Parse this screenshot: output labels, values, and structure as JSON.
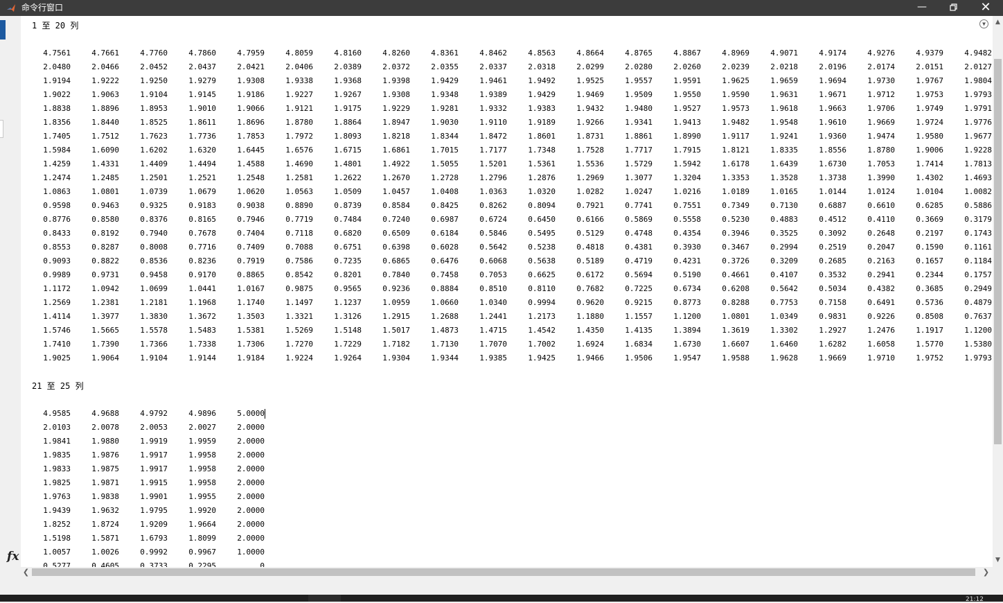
{
  "window": {
    "title": "命令行窗口",
    "controls": [
      "minimize-icon",
      "restore-icon",
      "close-icon"
    ],
    "accent": "#3c3c3c"
  },
  "console": {
    "block1_header": "1 至 20 列",
    "block2_header": "21 至 25 列",
    "block1_rows": [
      [
        "4.7561",
        "4.7661",
        "4.7760",
        "4.7860",
        "4.7959",
        "4.8059",
        "4.8160",
        "4.8260",
        "4.8361",
        "4.8462",
        "4.8563",
        "4.8664",
        "4.8765",
        "4.8867",
        "4.8969",
        "4.9071",
        "4.9174",
        "4.9276",
        "4.9379",
        "4.9482"
      ],
      [
        "2.0480",
        "2.0466",
        "2.0452",
        "2.0437",
        "2.0421",
        "2.0406",
        "2.0389",
        "2.0372",
        "2.0355",
        "2.0337",
        "2.0318",
        "2.0299",
        "2.0280",
        "2.0260",
        "2.0239",
        "2.0218",
        "2.0196",
        "2.0174",
        "2.0151",
        "2.0127"
      ],
      [
        "1.9194",
        "1.9222",
        "1.9250",
        "1.9279",
        "1.9308",
        "1.9338",
        "1.9368",
        "1.9398",
        "1.9429",
        "1.9461",
        "1.9492",
        "1.9525",
        "1.9557",
        "1.9591",
        "1.9625",
        "1.9659",
        "1.9694",
        "1.9730",
        "1.9767",
        "1.9804"
      ],
      [
        "1.9022",
        "1.9063",
        "1.9104",
        "1.9145",
        "1.9186",
        "1.9227",
        "1.9267",
        "1.9308",
        "1.9348",
        "1.9389",
        "1.9429",
        "1.9469",
        "1.9509",
        "1.9550",
        "1.9590",
        "1.9631",
        "1.9671",
        "1.9712",
        "1.9753",
        "1.9793"
      ],
      [
        "1.8838",
        "1.8896",
        "1.8953",
        "1.9010",
        "1.9066",
        "1.9121",
        "1.9175",
        "1.9229",
        "1.9281",
        "1.9332",
        "1.9383",
        "1.9432",
        "1.9480",
        "1.9527",
        "1.9573",
        "1.9618",
        "1.9663",
        "1.9706",
        "1.9749",
        "1.9791"
      ],
      [
        "1.8356",
        "1.8440",
        "1.8525",
        "1.8611",
        "1.8696",
        "1.8780",
        "1.8864",
        "1.8947",
        "1.9030",
        "1.9110",
        "1.9189",
        "1.9266",
        "1.9341",
        "1.9413",
        "1.9482",
        "1.9548",
        "1.9610",
        "1.9669",
        "1.9724",
        "1.9776"
      ],
      [
        "1.7405",
        "1.7512",
        "1.7623",
        "1.7736",
        "1.7853",
        "1.7972",
        "1.8093",
        "1.8218",
        "1.8344",
        "1.8472",
        "1.8601",
        "1.8731",
        "1.8861",
        "1.8990",
        "1.9117",
        "1.9241",
        "1.9360",
        "1.9474",
        "1.9580",
        "1.9677"
      ],
      [
        "1.5984",
        "1.6090",
        "1.6202",
        "1.6320",
        "1.6445",
        "1.6576",
        "1.6715",
        "1.6861",
        "1.7015",
        "1.7177",
        "1.7348",
        "1.7528",
        "1.7717",
        "1.7915",
        "1.8121",
        "1.8335",
        "1.8556",
        "1.8780",
        "1.9006",
        "1.9228"
      ],
      [
        "1.4259",
        "1.4331",
        "1.4409",
        "1.4494",
        "1.4588",
        "1.4690",
        "1.4801",
        "1.4922",
        "1.5055",
        "1.5201",
        "1.5361",
        "1.5536",
        "1.5729",
        "1.5942",
        "1.6178",
        "1.6439",
        "1.6730",
        "1.7053",
        "1.7414",
        "1.7813"
      ],
      [
        "1.2474",
        "1.2485",
        "1.2501",
        "1.2521",
        "1.2548",
        "1.2581",
        "1.2622",
        "1.2670",
        "1.2728",
        "1.2796",
        "1.2876",
        "1.2969",
        "1.3077",
        "1.3204",
        "1.3353",
        "1.3528",
        "1.3738",
        "1.3990",
        "1.4302",
        "1.4693"
      ],
      [
        "1.0863",
        "1.0801",
        "1.0739",
        "1.0679",
        "1.0620",
        "1.0563",
        "1.0509",
        "1.0457",
        "1.0408",
        "1.0363",
        "1.0320",
        "1.0282",
        "1.0247",
        "1.0216",
        "1.0189",
        "1.0165",
        "1.0144",
        "1.0124",
        "1.0104",
        "1.0082"
      ],
      [
        "0.9598",
        "0.9463",
        "0.9325",
        "0.9183",
        "0.9038",
        "0.8890",
        "0.8739",
        "0.8584",
        "0.8425",
        "0.8262",
        "0.8094",
        "0.7921",
        "0.7741",
        "0.7551",
        "0.7349",
        "0.7130",
        "0.6887",
        "0.6610",
        "0.6285",
        "0.5886"
      ],
      [
        "0.8776",
        "0.8580",
        "0.8376",
        "0.8165",
        "0.7946",
        "0.7719",
        "0.7484",
        "0.7240",
        "0.6987",
        "0.6724",
        "0.6450",
        "0.6166",
        "0.5869",
        "0.5558",
        "0.5230",
        "0.4883",
        "0.4512",
        "0.4110",
        "0.3669",
        "0.3179"
      ],
      [
        "0.8433",
        "0.8192",
        "0.7940",
        "0.7678",
        "0.7404",
        "0.7118",
        "0.6820",
        "0.6509",
        "0.6184",
        "0.5846",
        "0.5495",
        "0.5129",
        "0.4748",
        "0.4354",
        "0.3946",
        "0.3525",
        "0.3092",
        "0.2648",
        "0.2197",
        "0.1743"
      ],
      [
        "0.8553",
        "0.8287",
        "0.8008",
        "0.7716",
        "0.7409",
        "0.7088",
        "0.6751",
        "0.6398",
        "0.6028",
        "0.5642",
        "0.5238",
        "0.4818",
        "0.4381",
        "0.3930",
        "0.3467",
        "0.2994",
        "0.2519",
        "0.2047",
        "0.1590",
        "0.1161"
      ],
      [
        "0.9093",
        "0.8822",
        "0.8536",
        "0.8236",
        "0.7919",
        "0.7586",
        "0.7235",
        "0.6865",
        "0.6476",
        "0.6068",
        "0.5638",
        "0.5189",
        "0.4719",
        "0.4231",
        "0.3726",
        "0.3209",
        "0.2685",
        "0.2163",
        "0.1657",
        "0.1184"
      ],
      [
        "0.9989",
        "0.9731",
        "0.9458",
        "0.9170",
        "0.8865",
        "0.8542",
        "0.8201",
        "0.7840",
        "0.7458",
        "0.7053",
        "0.6625",
        "0.6172",
        "0.5694",
        "0.5190",
        "0.4661",
        "0.4107",
        "0.3532",
        "0.2941",
        "0.2344",
        "0.1757"
      ],
      [
        "1.1172",
        "1.0942",
        "1.0699",
        "1.0441",
        "1.0167",
        "0.9875",
        "0.9565",
        "0.9236",
        "0.8884",
        "0.8510",
        "0.8110",
        "0.7682",
        "0.7225",
        "0.6734",
        "0.6208",
        "0.5642",
        "0.5034",
        "0.4382",
        "0.3685",
        "0.2949"
      ],
      [
        "1.2569",
        "1.2381",
        "1.2181",
        "1.1968",
        "1.1740",
        "1.1497",
        "1.1237",
        "1.0959",
        "1.0660",
        "1.0340",
        "0.9994",
        "0.9620",
        "0.9215",
        "0.8773",
        "0.8288",
        "0.7753",
        "0.7158",
        "0.6491",
        "0.5736",
        "0.4879"
      ],
      [
        "1.4114",
        "1.3977",
        "1.3830",
        "1.3672",
        "1.3503",
        "1.3321",
        "1.3126",
        "1.2915",
        "1.2688",
        "1.2441",
        "1.2173",
        "1.1880",
        "1.1557",
        "1.1200",
        "1.0801",
        "1.0349",
        "0.9831",
        "0.9226",
        "0.8508",
        "0.7637"
      ],
      [
        "1.5746",
        "1.5665",
        "1.5578",
        "1.5483",
        "1.5381",
        "1.5269",
        "1.5148",
        "1.5017",
        "1.4873",
        "1.4715",
        "1.4542",
        "1.4350",
        "1.4135",
        "1.3894",
        "1.3619",
        "1.3302",
        "1.2927",
        "1.2476",
        "1.1917",
        "1.1200"
      ],
      [
        "1.7410",
        "1.7390",
        "1.7366",
        "1.7338",
        "1.7306",
        "1.7270",
        "1.7229",
        "1.7182",
        "1.7130",
        "1.7070",
        "1.7002",
        "1.6924",
        "1.6834",
        "1.6730",
        "1.6607",
        "1.6460",
        "1.6282",
        "1.6058",
        "1.5770",
        "1.5380"
      ],
      [
        "1.9025",
        "1.9064",
        "1.9104",
        "1.9144",
        "1.9184",
        "1.9224",
        "1.9264",
        "1.9304",
        "1.9344",
        "1.9385",
        "1.9425",
        "1.9466",
        "1.9506",
        "1.9547",
        "1.9588",
        "1.9628",
        "1.9669",
        "1.9710",
        "1.9752",
        "1.9793"
      ]
    ],
    "block2_rows": [
      [
        "4.9585",
        "4.9688",
        "4.9792",
        "4.9896",
        "5.0000"
      ],
      [
        "2.0103",
        "2.0078",
        "2.0053",
        "2.0027",
        "2.0000"
      ],
      [
        "1.9841",
        "1.9880",
        "1.9919",
        "1.9959",
        "2.0000"
      ],
      [
        "1.9835",
        "1.9876",
        "1.9917",
        "1.9958",
        "2.0000"
      ],
      [
        "1.9833",
        "1.9875",
        "1.9917",
        "1.9958",
        "2.0000"
      ],
      [
        "1.9825",
        "1.9871",
        "1.9915",
        "1.9958",
        "2.0000"
      ],
      [
        "1.9763",
        "1.9838",
        "1.9901",
        "1.9955",
        "2.0000"
      ],
      [
        "1.9439",
        "1.9632",
        "1.9795",
        "1.9920",
        "2.0000"
      ],
      [
        "1.8252",
        "1.8724",
        "1.9209",
        "1.9664",
        "2.0000"
      ],
      [
        "1.5198",
        "1.5871",
        "1.6793",
        "1.8099",
        "2.0000"
      ],
      [
        "1.0057",
        "1.0026",
        "0.9992",
        "0.9967",
        "1.0000"
      ],
      [
        "0.5277",
        "0.4605",
        "0.3733",
        "0.2295",
        "0"
      ]
    ]
  },
  "prompt": {
    "icon": "fx-icon",
    "label": "fx"
  },
  "taskbar": {
    "clock": "21:12"
  }
}
